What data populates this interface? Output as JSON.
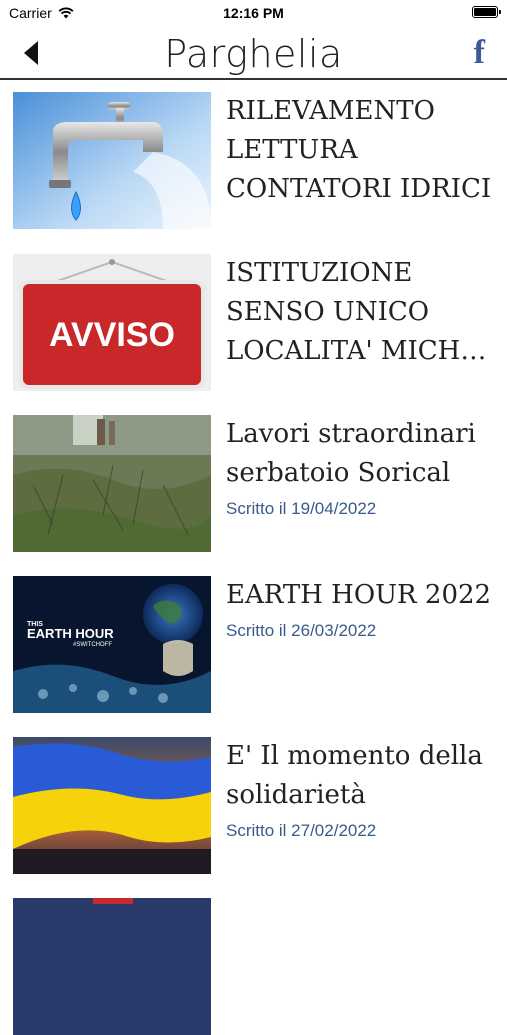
{
  "status_bar": {
    "carrier": "Carrier",
    "time": "12:16 PM"
  },
  "nav": {
    "title": "Parghelia",
    "facebook_label": "f"
  },
  "articles": [
    {
      "title": "RILEVAMENTO LETTURA CONTATORI IDRICI",
      "date": ""
    },
    {
      "title": "ISTITUZIONE SENSO UNICO LOCALITA' MICH…",
      "date": "",
      "thumb_text": "AVVISO"
    },
    {
      "title": "Lavori straordinari serbatoio Sorical",
      "date": "Scritto il 19/04/2022"
    },
    {
      "title": "EARTH HOUR 2022",
      "date": "Scritto il 26/03/2022",
      "thumb_text_1": "THIS",
      "thumb_text_2": "EARTH HOUR",
      "thumb_text_3": "#SWITCHOFF"
    },
    {
      "title": "E'  Il momento della solidarietà",
      "date": "Scritto il 27/02/2022"
    }
  ],
  "colors": {
    "date_text": "#3a5a8a",
    "facebook": "#3b5998"
  }
}
